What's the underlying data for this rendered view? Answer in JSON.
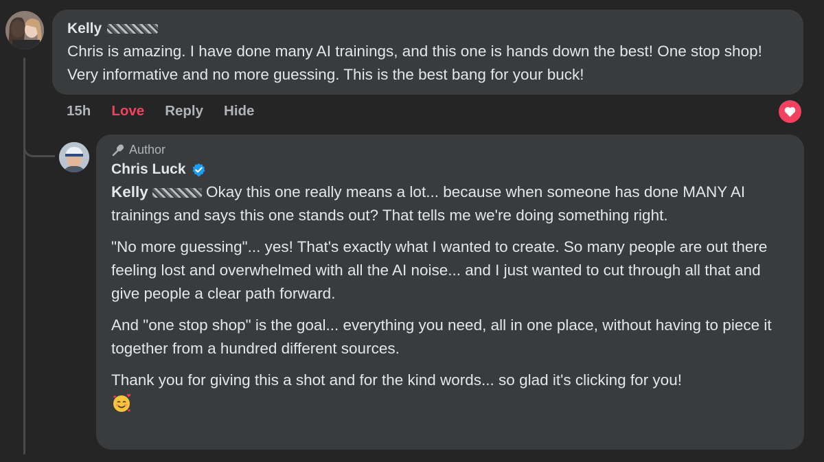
{
  "parent_comment": {
    "author_first": "Kelly",
    "text": "Chris is amazing. I have done many AI trainings, and this one is hands down the best! One stop shop! Very informative and no more guessing. This is the best bang for your buck!",
    "time": "15h",
    "actions": {
      "love": "Love",
      "reply": "Reply",
      "hide": "Hide"
    },
    "reaction_icon": "heart-icon",
    "colors": {
      "love": "#f3425f",
      "bubble": "#3a3b3c",
      "background": "#252526"
    }
  },
  "reply": {
    "badge": "Author",
    "author": "Chris Luck",
    "verified_icon": "verified-check-icon",
    "mention_first": "Kelly",
    "paragraphs": [
      "Okay this one really means a lot... because when someone has done MANY AI trainings and says this one stands out? That tells me we're doing something right.",
      "\"No more guessing\"... yes! That's exactly what I wanted to create. So many people are out there feeling lost and overwhelmed with all the AI noise... and I just wanted to cut through all that and give people a clear path forward.",
      "And \"one stop shop\" is the goal... everything you need, all in one place, without having to piece it together from a hundred different sources.",
      "Thank you for giving this a shot and for the kind words... so glad it's clicking for you!"
    ],
    "emoji": "🥰",
    "colors": {
      "verified": "#1d9bf0"
    }
  }
}
